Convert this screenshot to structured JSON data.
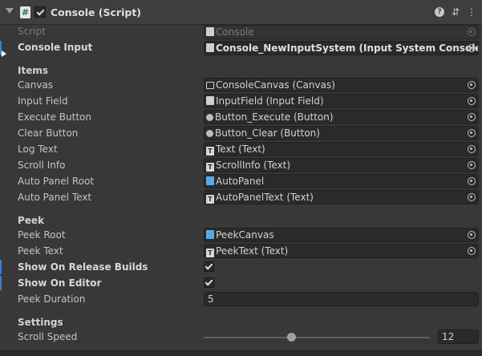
{
  "header": {
    "title": "Console (Script)"
  },
  "script": {
    "label": "Script",
    "value": "Console"
  },
  "console_input": {
    "label": "Console Input",
    "value": "Console_NewInputSystem (Input System Console Inp"
  },
  "items": {
    "heading": "Items",
    "fields": [
      {
        "label": "Canvas",
        "value": "ConsoleCanvas (Canvas)",
        "icon": "canvas-icon"
      },
      {
        "label": "Input Field",
        "value": "InputField (Input Field)",
        "icon": "input-field-icon"
      },
      {
        "label": "Execute Button",
        "value": "Button_Execute (Button)",
        "icon": "button-icon"
      },
      {
        "label": "Clear Button",
        "value": "Button_Clear (Button)",
        "icon": "button-icon"
      },
      {
        "label": "Log Text",
        "value": "Text (Text)",
        "icon": "text-icon"
      },
      {
        "label": "Scroll Info",
        "value": "ScrollInfo (Text)",
        "icon": "text-icon"
      },
      {
        "label": "Auto Panel Root",
        "value": "AutoPanel",
        "icon": "cube-icon"
      },
      {
        "label": "Auto Panel Text",
        "value": "AutoPanelText (Text)",
        "icon": "text-icon"
      }
    ]
  },
  "peek": {
    "heading": "Peek",
    "root": {
      "label": "Peek Root",
      "value": "PeekCanvas"
    },
    "text": {
      "label": "Peek Text",
      "value": "PeekText (Text)"
    },
    "show_on_release": {
      "label": "Show On Release Builds",
      "checked": true
    },
    "show_on_editor": {
      "label": "Show On Editor",
      "checked": true
    },
    "duration": {
      "label": "Peek Duration",
      "value": "5"
    }
  },
  "settings": {
    "heading": "Settings",
    "scroll_speed": {
      "label": "Scroll Speed",
      "value": "12"
    }
  },
  "colors": {
    "background": "#383838",
    "field": "#2a2a2a",
    "override": "#3b7dd8"
  }
}
